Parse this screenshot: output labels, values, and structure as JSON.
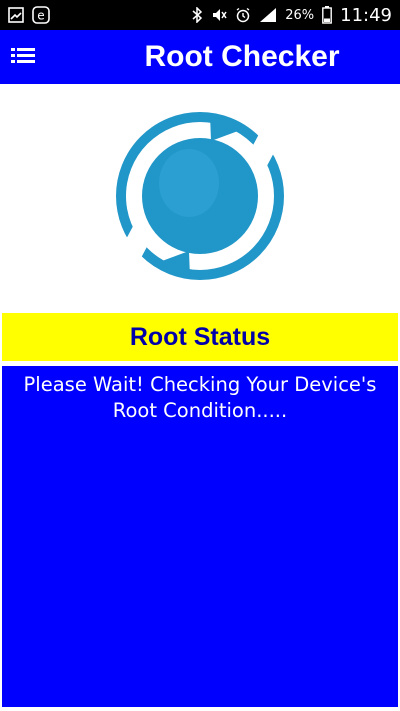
{
  "status_bar": {
    "battery_percent": "26%",
    "time": "11:49",
    "left_icons": [
      "gallery-icon",
      "e-browser-icon"
    ],
    "right_icons": [
      "bluetooth-icon",
      "mute-icon",
      "alarm-icon",
      "signal-icon",
      "battery-icon"
    ]
  },
  "app_bar": {
    "title": "Root Checker",
    "menu_icon": "list-menu-icon"
  },
  "logo": {
    "icon": "refresh-sync-icon",
    "color": "#2196c8"
  },
  "status": {
    "header": "Root Status",
    "message": "Please Wait!  Checking Your Device's Root Condition....."
  },
  "colors": {
    "app_bar": "#0000ff",
    "header_bg": "#ffff00",
    "header_text": "#0000aa",
    "panel_bg": "#0000ff"
  }
}
